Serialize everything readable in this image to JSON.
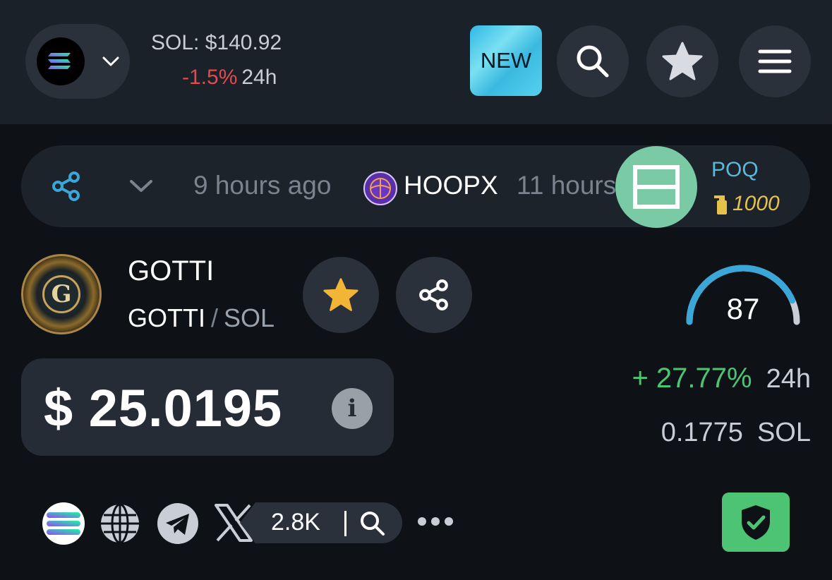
{
  "header": {
    "chain": {
      "icon": "solana-logo-icon",
      "dropdown_icon": "chevron-down-icon"
    },
    "sol_price": "SOL: $140.92",
    "sol_change": "-1.5%",
    "sol_period": "24h",
    "new_button": "NEW",
    "search_icon": "search-icon",
    "favorites_icon": "star-icon",
    "menu_icon": "hamburger-menu-icon"
  },
  "ticker": {
    "share_icon": "share-icon",
    "expand_icon": "chevron-down-icon",
    "items": [
      {
        "time": "9 hours ago"
      },
      {
        "token": "HOOPX",
        "time": "11 hours"
      }
    ],
    "promo": {
      "name": "POQ",
      "score": "1000",
      "icon": "ad-layout-icon",
      "score_icon": "spray-bottle-icon"
    }
  },
  "token": {
    "name": "GOTTI",
    "pair_base": "GOTTI",
    "pair_separator": "/",
    "pair_quote": "SOL",
    "logo_letter": "G",
    "price": "$ 25.0195",
    "score": "87",
    "score_fraction": 0.87,
    "change": "+ 27.77%",
    "change_period": "24h",
    "sol_value": "0.1775",
    "sol_unit": "SOL",
    "info_glyph": "i"
  },
  "links": {
    "x_followers": "2.8K",
    "icons": [
      "solana-icon",
      "website-globe-icon",
      "telegram-icon",
      "x-twitter-icon",
      "search-icon",
      "more-dots-icon",
      "security-shield-icon"
    ]
  },
  "colors": {
    "background": "#0e1216",
    "header": "#1b2129",
    "negative": "#e5484d",
    "positive": "#4cc474",
    "accent_cyan": "#56d0ef",
    "star_gold": "#f2b535",
    "gauge_blue": "#3aa7d8"
  }
}
